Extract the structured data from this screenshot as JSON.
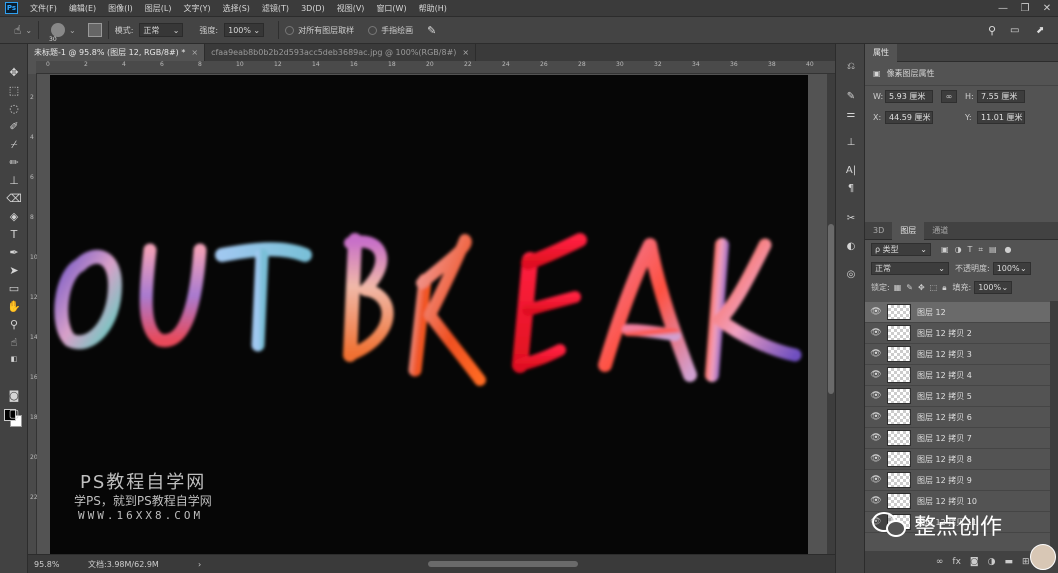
{
  "app": {
    "logo": "Ps"
  },
  "menu": [
    "文件(F)",
    "编辑(E)",
    "图像(I)",
    "图层(L)",
    "文字(Y)",
    "选择(S)",
    "滤镜(T)",
    "3D(D)",
    "视图(V)",
    "窗口(W)",
    "帮助(H)"
  ],
  "window_controls": [
    "—",
    "❐",
    "✕"
  ],
  "options": {
    "brush_size": "30",
    "mode_label": "模式:",
    "mode_value": "正常",
    "strength_label": "强度:",
    "strength_value": "100%",
    "sample_all_label": "对所有图层取样",
    "finger_paint_label": "手指绘画"
  },
  "tabs": [
    {
      "title": "未标题-1 @ 95.8% (图层 12, RGB/8#) *",
      "close": "×"
    },
    {
      "title": "cfaa9eab8b0b2b2d593acc5deb3689ac.jpg @ 100%(RGB/8#)",
      "close": "×"
    }
  ],
  "ruler_h_labels": [
    "0",
    "2",
    "4",
    "6",
    "8",
    "10",
    "12",
    "14",
    "16",
    "18",
    "20",
    "22",
    "24",
    "26",
    "28",
    "30",
    "32",
    "34",
    "36",
    "38",
    "40"
  ],
  "ruler_v_labels": [
    "2",
    "4",
    "6",
    "8",
    "10",
    "12",
    "14",
    "16",
    "18",
    "20",
    "22"
  ],
  "canvas": {
    "art_text": "OUTBREAK"
  },
  "status": {
    "zoom": "95.8%",
    "doc": "文档:3.98M/62.9M",
    "arrow": "›"
  },
  "properties": {
    "tabs": [
      "属性"
    ],
    "subtitle": "像素图层属性",
    "w_label": "W:",
    "w_value": "5.93 厘米",
    "h_label": "H:",
    "h_value": "7.55 厘米",
    "x_label": "X:",
    "x_value": "44.59 厘米",
    "y_label": "Y:",
    "y_value": "11.01 厘米",
    "link": "∞"
  },
  "layers_panel": {
    "tabs": [
      "3D",
      "图层",
      "通道"
    ],
    "filter_label": "ρ 类型",
    "blend_mode": "正常",
    "opacity_label": "不透明度:",
    "opacity_value": "100%",
    "lock_label": "锁定:",
    "fill_label": "填充:",
    "fill_value": "100%",
    "layers": [
      {
        "name": "图层 12",
        "selected": true
      },
      {
        "name": "图层 12 拷贝 2"
      },
      {
        "name": "图层 12 拷贝 3"
      },
      {
        "name": "图层 12 拷贝 4"
      },
      {
        "name": "图层 12 拷贝 5"
      },
      {
        "name": "图层 12 拷贝 6"
      },
      {
        "name": "图层 12 拷贝 7"
      },
      {
        "name": "图层 12 拷贝 8"
      },
      {
        "name": "图层 12 拷贝 9"
      },
      {
        "name": "图层 12 拷贝 10"
      },
      {
        "name": "图层 12 拷贝 11"
      }
    ],
    "bottom_icons": [
      "link-icon",
      "fx-icon",
      "mask-icon",
      "adjustment-icon",
      "folder-icon",
      "new-layer-icon",
      "trash-icon"
    ]
  },
  "watermark": {
    "line1": "PS教程自学网",
    "line2": "学PS，就到PS教程自学网",
    "line3": "WWW.16XX8.COM"
  },
  "wechat_watermark": {
    "text": "整点创作"
  }
}
